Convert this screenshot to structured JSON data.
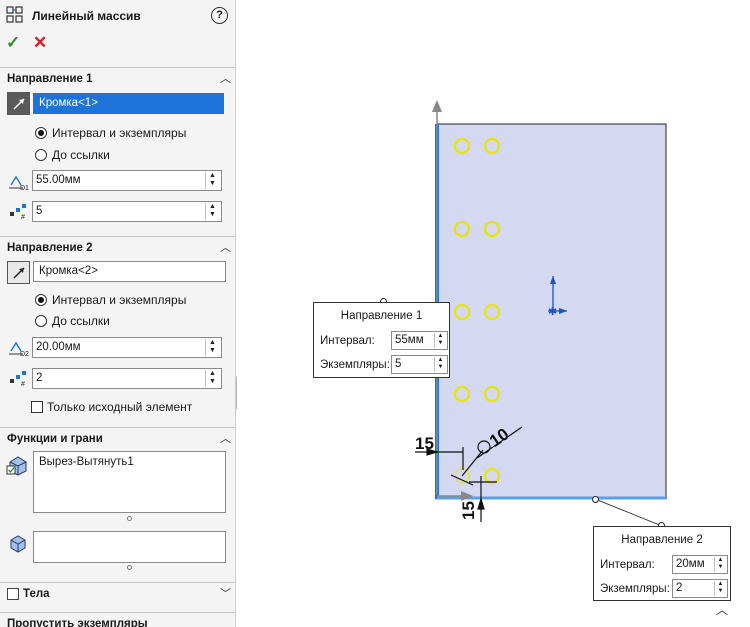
{
  "panel": {
    "title": "Линейный массив",
    "help_label": "?",
    "ok_label": "✓",
    "cancel_label": "✕"
  },
  "direction1": {
    "header": "Направление 1",
    "edge": "Кромка<1>",
    "option_interval": "Интервал и экземпляры",
    "option_reference": "До ссылки",
    "spacing": "55.00мм",
    "count": "5",
    "spacing_icon_label": "D1"
  },
  "direction2": {
    "header": "Направление 2",
    "edge": "Кромка<2>",
    "option_interval": "Интервал и экземпляры",
    "option_reference": "До ссылки",
    "spacing": "20.00мм",
    "count": "2",
    "spacing_icon_label": "D2",
    "seed_only_label": "Только исходный элемент"
  },
  "features": {
    "header": "Функции и грани",
    "feature_item": "Вырез-Вытянуть1",
    "faces_value": ""
  },
  "bodies": {
    "header": "Тела"
  },
  "skip": {
    "header": "Пропустить экземпляры"
  },
  "callout1": {
    "title": "Направление 1",
    "interval_label": "Интервал:",
    "interval_value": "55мм",
    "count_label": "Экземпляры:",
    "count_value": "5"
  },
  "callout2": {
    "title": "Направление 2",
    "interval_label": "Интервал:",
    "interval_value": "20мм",
    "count_label": "Экземпляры:",
    "count_value": "2"
  },
  "dimensions": {
    "left_offset": "15",
    "bottom_offset": "15",
    "diameter": "10"
  },
  "colors": {
    "accent": "#1e73d8",
    "plate_fill": "#d4d8f0",
    "hole_preview": "#e6e600",
    "ok": "#2e8b2e",
    "cancel": "#d12020"
  }
}
